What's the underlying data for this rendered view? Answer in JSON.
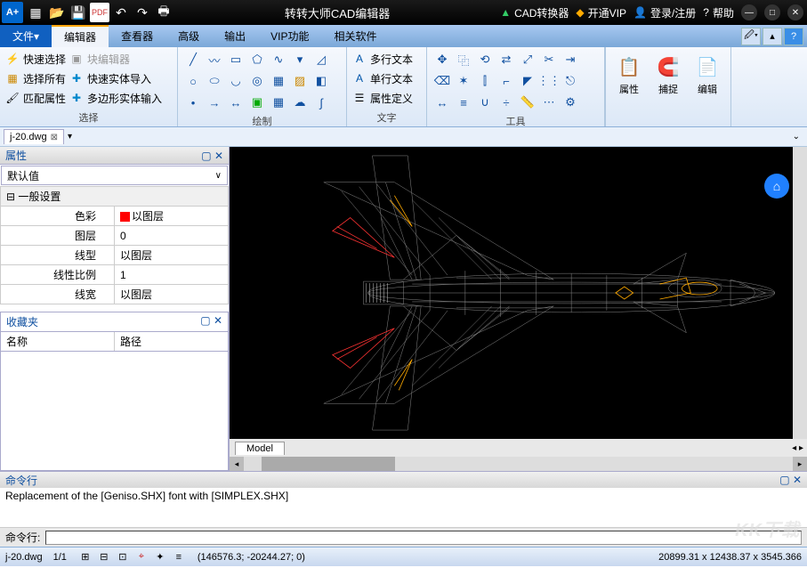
{
  "app": {
    "title": "转转大师CAD编辑器",
    "logo": "A+"
  },
  "titlebar": {
    "right": {
      "converter": "CAD转换器",
      "vip": "开通VIP",
      "login": "登录/注册",
      "help": "帮助"
    }
  },
  "menu": {
    "file": "文件",
    "tabs": [
      "编辑器",
      "查看器",
      "高级",
      "输出",
      "VIP功能",
      "相关软件"
    ]
  },
  "ribbon": {
    "select": {
      "label": "选择",
      "items": [
        "快速选择",
        "块编辑器",
        "选择所有",
        "快速实体导入",
        "匹配属性",
        "多边形实体输入"
      ]
    },
    "draw": {
      "label": "绘制"
    },
    "text": {
      "label": "文字",
      "items": [
        "多行文本",
        "单行文本",
        "属性定义"
      ]
    },
    "tools": {
      "label": "工具"
    },
    "props": "属性",
    "snap": "捕捉",
    "edit": "编辑"
  },
  "doc": {
    "name": "j-20.dwg"
  },
  "panel": {
    "title": "属性",
    "default": "默认值",
    "category": "一般设置",
    "rows": [
      {
        "k": "色彩",
        "v": "以图层",
        "swatch": true
      },
      {
        "k": "图层",
        "v": "0"
      },
      {
        "k": "线型",
        "v": "以图层"
      },
      {
        "k": "线性比例",
        "v": "1"
      },
      {
        "k": "线宽",
        "v": "以图层"
      }
    ],
    "fav": {
      "title": "收藏夹",
      "cols": [
        "名称",
        "路径"
      ]
    }
  },
  "model_tab": "Model",
  "cmd": {
    "title": "命令行",
    "log": "Replacement of the [Geniso.SHX] font with [SIMPLEX.SHX]",
    "prompt": "命令行:"
  },
  "status": {
    "file": "j-20.dwg",
    "page": "1/1",
    "coords": "(146576.3; -20244.27; 0)",
    "dim": "20899.31 x 12438.37 x 3545.366"
  },
  "watermark": "KK下载"
}
